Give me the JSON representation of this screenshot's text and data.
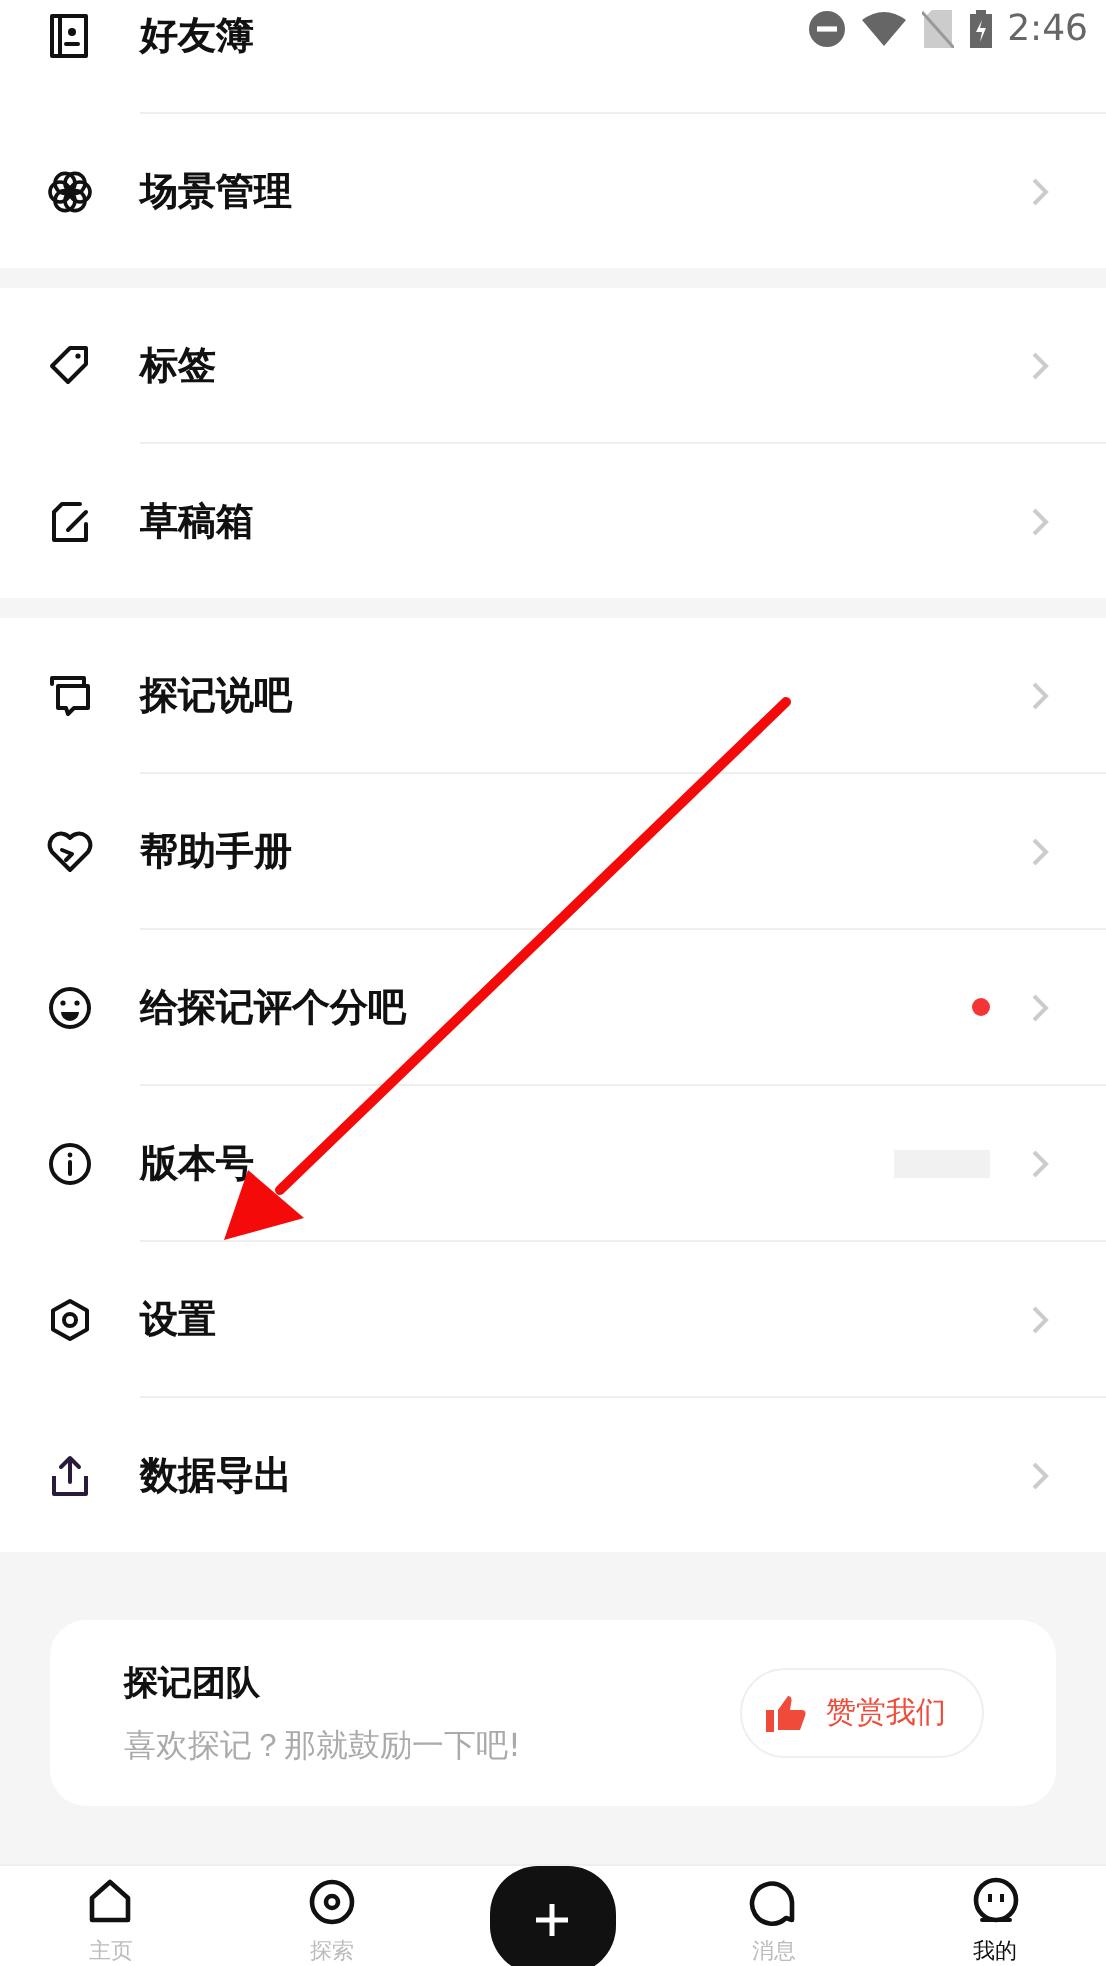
{
  "status_bar": {
    "time": "2:46"
  },
  "groups": [
    {
      "items": [
        {
          "label": "好友簿",
          "dot": false
        },
        {
          "label": "场景管理",
          "dot": false
        }
      ]
    },
    {
      "items": [
        {
          "label": "标签",
          "dot": false
        },
        {
          "label": "草稿箱",
          "dot": false
        }
      ]
    },
    {
      "items": [
        {
          "label": "探记说吧",
          "dot": false
        },
        {
          "label": "帮助手册",
          "dot": false
        },
        {
          "label": "给探记评个分吧",
          "dot": true
        },
        {
          "label": "版本号",
          "dot": false
        },
        {
          "label": "设置",
          "dot": false
        },
        {
          "label": "数据导出",
          "dot": false
        }
      ]
    }
  ],
  "team_card": {
    "title": "探记团队",
    "subtitle": "喜欢探记？那就鼓励一下吧!",
    "button": "赞赏我们"
  },
  "bottom_nav": [
    {
      "kind": "tab",
      "label": "主页",
      "selected": false
    },
    {
      "kind": "tab",
      "label": "探索",
      "selected": false
    },
    {
      "kind": "add"
    },
    {
      "kind": "tab",
      "label": "消息",
      "selected": false
    },
    {
      "kind": "tab",
      "label": "我的",
      "selected": true
    }
  ]
}
